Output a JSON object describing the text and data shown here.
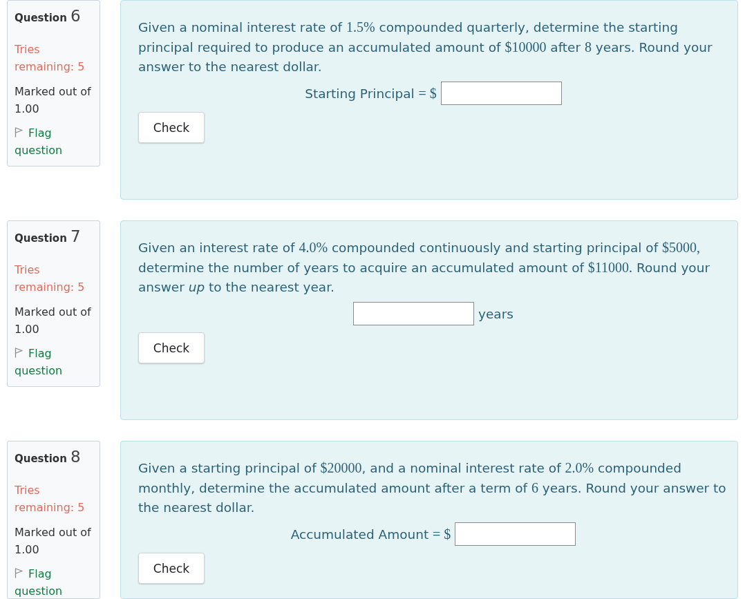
{
  "questions": [
    {
      "label": "Question",
      "number": "6",
      "tries": "Tries remaining: 5",
      "marks": "Marked out of 1.00",
      "flag": "Flag question",
      "text": [
        {
          "kind": "text",
          "text": "Given a nominal interest rate of "
        },
        {
          "kind": "math",
          "text": "1.5%"
        },
        {
          "kind": "text",
          "text": " compounded quarterly, determine the starting principal required to produce an accumulated amount of "
        },
        {
          "kind": "math",
          "text": "$10000"
        },
        {
          "kind": "text",
          "text": " after "
        },
        {
          "kind": "math",
          "text": "8"
        },
        {
          "kind": "text",
          "text": " years. Round your answer to the nearest dollar."
        }
      ],
      "answer": {
        "before": [
          {
            "kind": "text",
            "text": "Starting Principal "
          },
          {
            "kind": "math",
            "text": "= $"
          }
        ]
      },
      "button": "Check"
    },
    {
      "label": "Question",
      "number": "7",
      "tries": "Tries remaining: 5",
      "marks": "Marked out of 1.00",
      "flag": "Flag question",
      "text": [
        {
          "kind": "text",
          "text": "Given an interest rate of "
        },
        {
          "kind": "math",
          "text": "4.0%"
        },
        {
          "kind": "text",
          "text": " compounded continuously and starting principal of "
        },
        {
          "kind": "math",
          "text": "$5000,"
        },
        {
          "kind": "text",
          "text": " determine the number of years to acquire an accumulated amount of "
        },
        {
          "kind": "math",
          "text": "$11000."
        },
        {
          "kind": "text",
          "text": " Round your answer *up* to the nearest year."
        }
      ],
      "answer": {
        "after": [
          {
            "kind": "text",
            "text": "years"
          }
        ]
      },
      "button": "Check"
    },
    {
      "label": "Question",
      "number": "8",
      "tries": "Tries remaining: 5",
      "marks": "Marked out of 1.00",
      "flag": "Flag question",
      "text": [
        {
          "kind": "text",
          "text": "Given a starting principal of "
        },
        {
          "kind": "math",
          "text": "$20000"
        },
        {
          "kind": "text",
          "text": ", and a nominal interest rate of "
        },
        {
          "kind": "math",
          "text": "2.0%"
        },
        {
          "kind": "text",
          "text": " compounded monthly, determine the accumulated amount after a term of "
        },
        {
          "kind": "math",
          "text": "6"
        },
        {
          "kind": "text",
          "text": " years. Round your answer to the nearest dollar."
        }
      ],
      "answer": {
        "before": [
          {
            "kind": "text",
            "text": "Accumulated Amount "
          },
          {
            "kind": "math",
            "text": "= $"
          }
        ]
      },
      "button": "Check"
    }
  ]
}
